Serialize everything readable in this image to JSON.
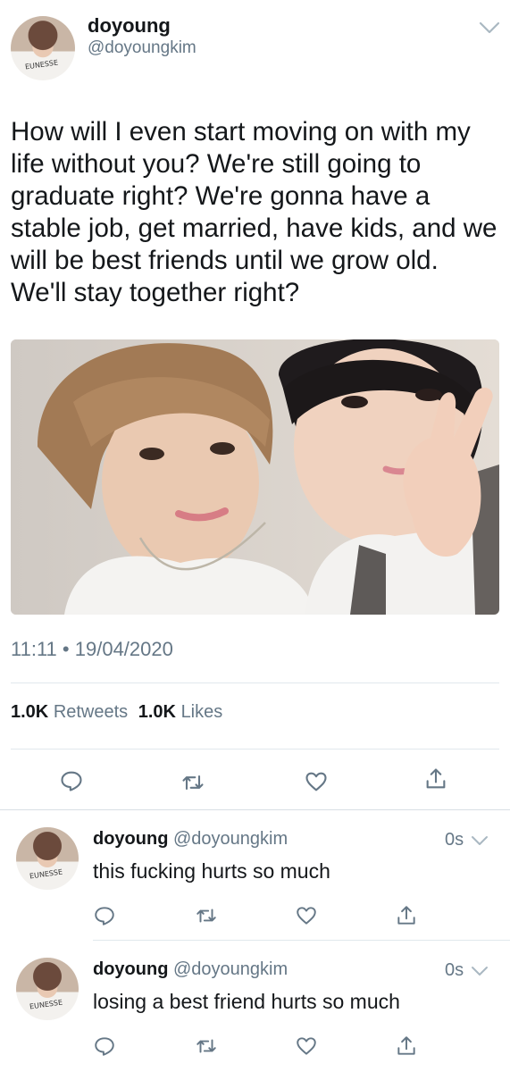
{
  "main_tweet": {
    "display_name": "doyoung",
    "handle": "@doyoungkim",
    "text": "How will I even start moving on with my life without you? We're still going to graduate right? We're gonna have a stable job, get married, have kids, and we will be best friends until we grow old. We'll stay together right?",
    "time": "11:11",
    "date": "19/04/2020",
    "retweet_count": "1.0K",
    "retweet_label": "Retweets",
    "like_count": "1.0K",
    "like_label": "Likes",
    "avatar_shirt_text": "EUNESSE",
    "photo_alt": "selfie photo"
  },
  "replies": [
    {
      "display_name": "doyoung",
      "handle": "@doyoungkim",
      "time": "0s",
      "text": "this fucking hurts so much",
      "avatar_shirt_text": "EUNESSE"
    },
    {
      "display_name": "doyoung",
      "handle": "@doyoungkim",
      "time": "0s",
      "text": "losing a best friend hurts so much",
      "avatar_shirt_text": "EUNESSE"
    }
  ],
  "icons": [
    "reply-icon",
    "retweet-icon",
    "like-icon",
    "share-icon",
    "chevron-down-icon"
  ],
  "colors": {
    "text_primary": "#14171a",
    "text_secondary": "#657786",
    "divider": "#e1e8ed"
  }
}
